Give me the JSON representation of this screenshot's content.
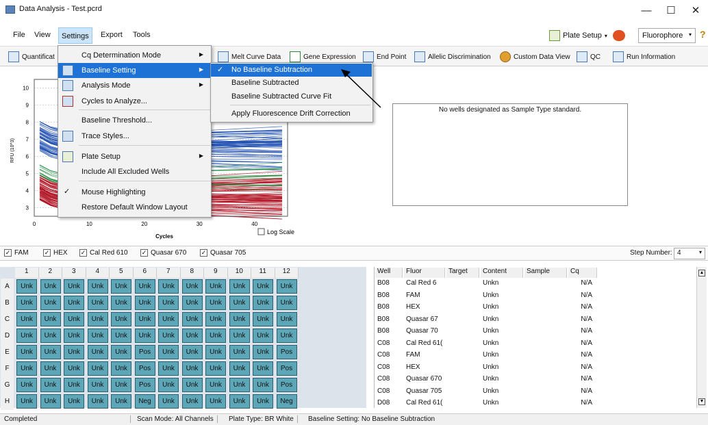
{
  "window": {
    "title": "Data Analysis - Test.pcrd",
    "minimize": "—",
    "maximize": "☐",
    "close": "✕"
  },
  "menubar": [
    "File",
    "View",
    "Settings",
    "Export",
    "Tools"
  ],
  "topright": {
    "plate_setup": "Plate Setup",
    "fluorophore": "Fluorophore",
    "help": "?"
  },
  "toolbar": [
    "Quantificat",
    "Melt Curve Data",
    "Gene Expression",
    "End Point",
    "Allelic Discrimination",
    "Custom Data View",
    "QC",
    "Run Information"
  ],
  "settings_menu": [
    {
      "label": "Cq Determination Mode",
      "submenu": true
    },
    {
      "label": "Baseline Setting",
      "submenu": true,
      "highlighted": true
    },
    {
      "label": "Analysis Mode",
      "submenu": true
    },
    {
      "label": "Cycles to Analyze..."
    },
    {
      "label": "Baseline Threshold..."
    },
    {
      "label": "Trace Styles..."
    },
    {
      "label": "Plate Setup",
      "submenu": true
    },
    {
      "label": "Include All Excluded Wells"
    },
    {
      "label": "Mouse Highlighting",
      "checked": true
    },
    {
      "label": "Restore Default Window Layout"
    }
  ],
  "baseline_submenu": [
    {
      "label": "No Baseline Subtraction",
      "checked": true,
      "highlighted": true
    },
    {
      "label": "Baseline Subtracted"
    },
    {
      "label": "Baseline Subtracted Curve Fit"
    },
    {
      "label": "Apply Fluorescence Drift Correction"
    }
  ],
  "chart": {
    "ylabel": "RFU (10^3)",
    "xlabel": "Cycles",
    "xticks": [
      "0",
      "10",
      "20",
      "30",
      "40"
    ],
    "yticks": [
      "3",
      "4",
      "5",
      "6",
      "7",
      "8",
      "9",
      "10"
    ],
    "log_scale_label": "Log Scale"
  },
  "std_message": "No wells designated as Sample Type standard.",
  "filters": [
    "FAM",
    "HEX",
    "Cal Red 610",
    "Quasar 670",
    "Quasar 705"
  ],
  "step": {
    "label": "Step Number:",
    "value": "4"
  },
  "plate": {
    "columns": [
      "1",
      "2",
      "3",
      "4",
      "5",
      "6",
      "7",
      "8",
      "9",
      "10",
      "11",
      "12"
    ],
    "rows": [
      {
        "label": "A",
        "wells": [
          "Unk",
          "Unk",
          "Unk",
          "Unk",
          "Unk",
          "Unk",
          "Unk",
          "Unk",
          "Unk",
          "Unk",
          "Unk",
          "Unk"
        ]
      },
      {
        "label": "B",
        "wells": [
          "Unk",
          "Unk",
          "Unk",
          "Unk",
          "Unk",
          "Unk",
          "Unk",
          "Unk",
          "Unk",
          "Unk",
          "Unk",
          "Unk"
        ]
      },
      {
        "label": "C",
        "wells": [
          "Unk",
          "Unk",
          "Unk",
          "Unk",
          "Unk",
          "Unk",
          "Unk",
          "Unk",
          "Unk",
          "Unk",
          "Unk",
          "Unk"
        ]
      },
      {
        "label": "D",
        "wells": [
          "Unk",
          "Unk",
          "Unk",
          "Unk",
          "Unk",
          "Unk",
          "Unk",
          "Unk",
          "Unk",
          "Unk",
          "Unk",
          "Unk"
        ]
      },
      {
        "label": "E",
        "wells": [
          "Unk",
          "Unk",
          "Unk",
          "Unk",
          "Unk",
          "Pos",
          "Unk",
          "Unk",
          "Unk",
          "Unk",
          "Unk",
          "Pos"
        ]
      },
      {
        "label": "F",
        "wells": [
          "Unk",
          "Unk",
          "Unk",
          "Unk",
          "Unk",
          "Pos",
          "Unk",
          "Unk",
          "Unk",
          "Unk",
          "Unk",
          "Pos"
        ]
      },
      {
        "label": "G",
        "wells": [
          "Unk",
          "Unk",
          "Unk",
          "Unk",
          "Unk",
          "Pos",
          "Unk",
          "Unk",
          "Unk",
          "Unk",
          "Unk",
          "Pos"
        ]
      },
      {
        "label": "H",
        "wells": [
          "Unk",
          "Unk",
          "Unk",
          "Unk",
          "Unk",
          "Neg",
          "Unk",
          "Unk",
          "Unk",
          "Unk",
          "Unk",
          "Neg"
        ]
      }
    ]
  },
  "table": {
    "headers": [
      "Well",
      "Fluor",
      "Target",
      "Content",
      "Sample",
      "Cq"
    ],
    "rows": [
      [
        "B08",
        "Cal Red 6",
        "",
        "Unkn",
        "",
        "N/A"
      ],
      [
        "B08",
        "FAM",
        "",
        "Unkn",
        "",
        "N/A"
      ],
      [
        "B08",
        "HEX",
        "",
        "Unkn",
        "",
        "N/A"
      ],
      [
        "B08",
        "Quasar 67",
        "",
        "Unkn",
        "",
        "N/A"
      ],
      [
        "B08",
        "Quasar 70",
        "",
        "Unkn",
        "",
        "N/A"
      ],
      [
        "C08",
        "Cal Red 61(",
        "",
        "Unkn",
        "",
        "N/A"
      ],
      [
        "C08",
        "FAM",
        "",
        "Unkn",
        "",
        "N/A"
      ],
      [
        "C08",
        "HEX",
        "",
        "Unkn",
        "",
        "N/A"
      ],
      [
        "C08",
        "Quasar 670",
        "",
        "Unkn",
        "",
        "N/A"
      ],
      [
        "C08",
        "Quasar 705",
        "",
        "Unkn",
        "",
        "N/A"
      ],
      [
        "D08",
        "Cal Red 61(",
        "",
        "Unkn",
        "",
        "N/A"
      ]
    ]
  },
  "status": {
    "state": "Completed",
    "scan_mode": "Scan Mode: All Channels",
    "plate_type": "Plate Type: BR White",
    "baseline": "Baseline Setting: No Baseline Subtraction"
  },
  "colors": {
    "menu_highlight": "#1e72d6",
    "well": "#5da6b8",
    "curve_blue": "#1f4fb0",
    "curve_red": "#b01020",
    "curve_green": "#1a8a3a"
  }
}
